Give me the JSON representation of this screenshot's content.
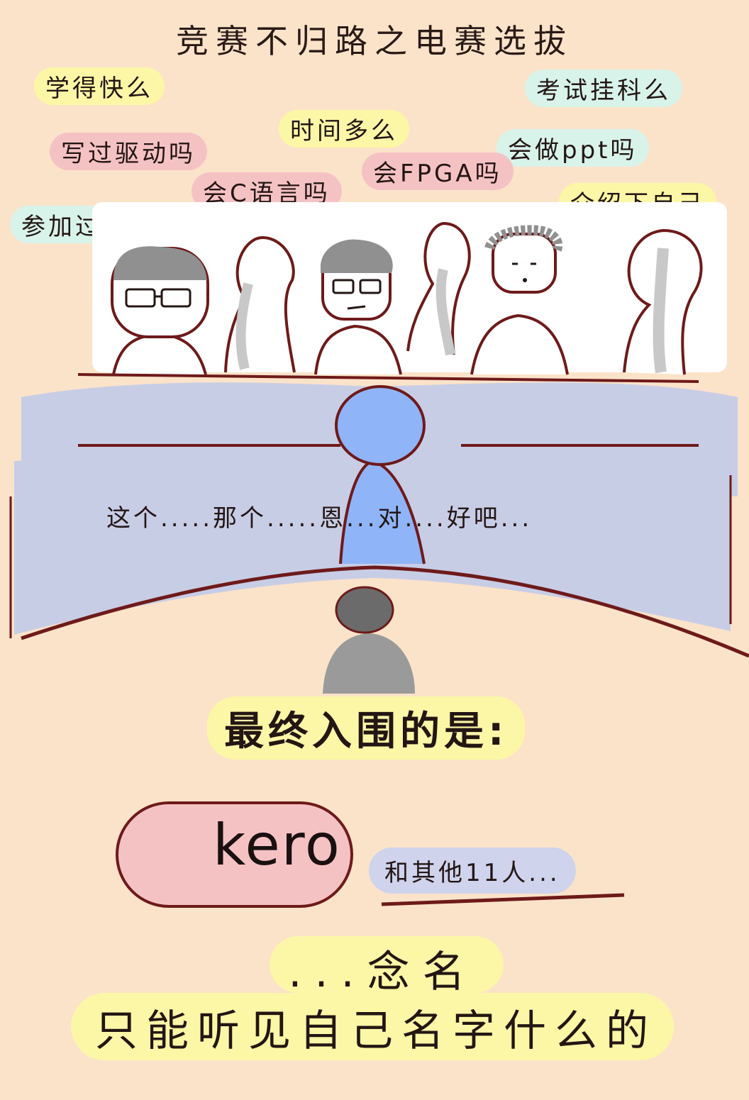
{
  "title": "竞赛不归路之电赛选拔",
  "questions": [
    {
      "text": "学得快么",
      "style": "yellow"
    },
    {
      "text": "考试挂科么",
      "style": "cyan"
    },
    {
      "text": "时间多么",
      "style": "yellow"
    },
    {
      "text": "写过驱动吗",
      "style": "pink"
    },
    {
      "text": "会做ppt吗",
      "style": "cyan"
    },
    {
      "text": "会FPGA吗",
      "style": "pink"
    },
    {
      "text": "会C语言吗",
      "style": "pink"
    },
    {
      "text": "介绍下自己",
      "style": "yellow"
    },
    {
      "text": "参加过比赛么",
      "style": "cyan"
    }
  ],
  "candidate_speech": "这个.....那个.....恩...对....好吧...",
  "result": {
    "heading": "最终入围的是:",
    "name": "kero",
    "others": "和其他11人...",
    "reading": "...念名单...",
    "conclusion": "只能听见自己名字什么的"
  },
  "colors": {
    "background": "#fbe3c9",
    "yellow": "#fbf7a6",
    "pink": "#f5c2c4",
    "cyan": "#d8f3ea",
    "table": "#c8cde6",
    "candidate": "#8fb4f7",
    "outline": "#6e1a1a"
  }
}
